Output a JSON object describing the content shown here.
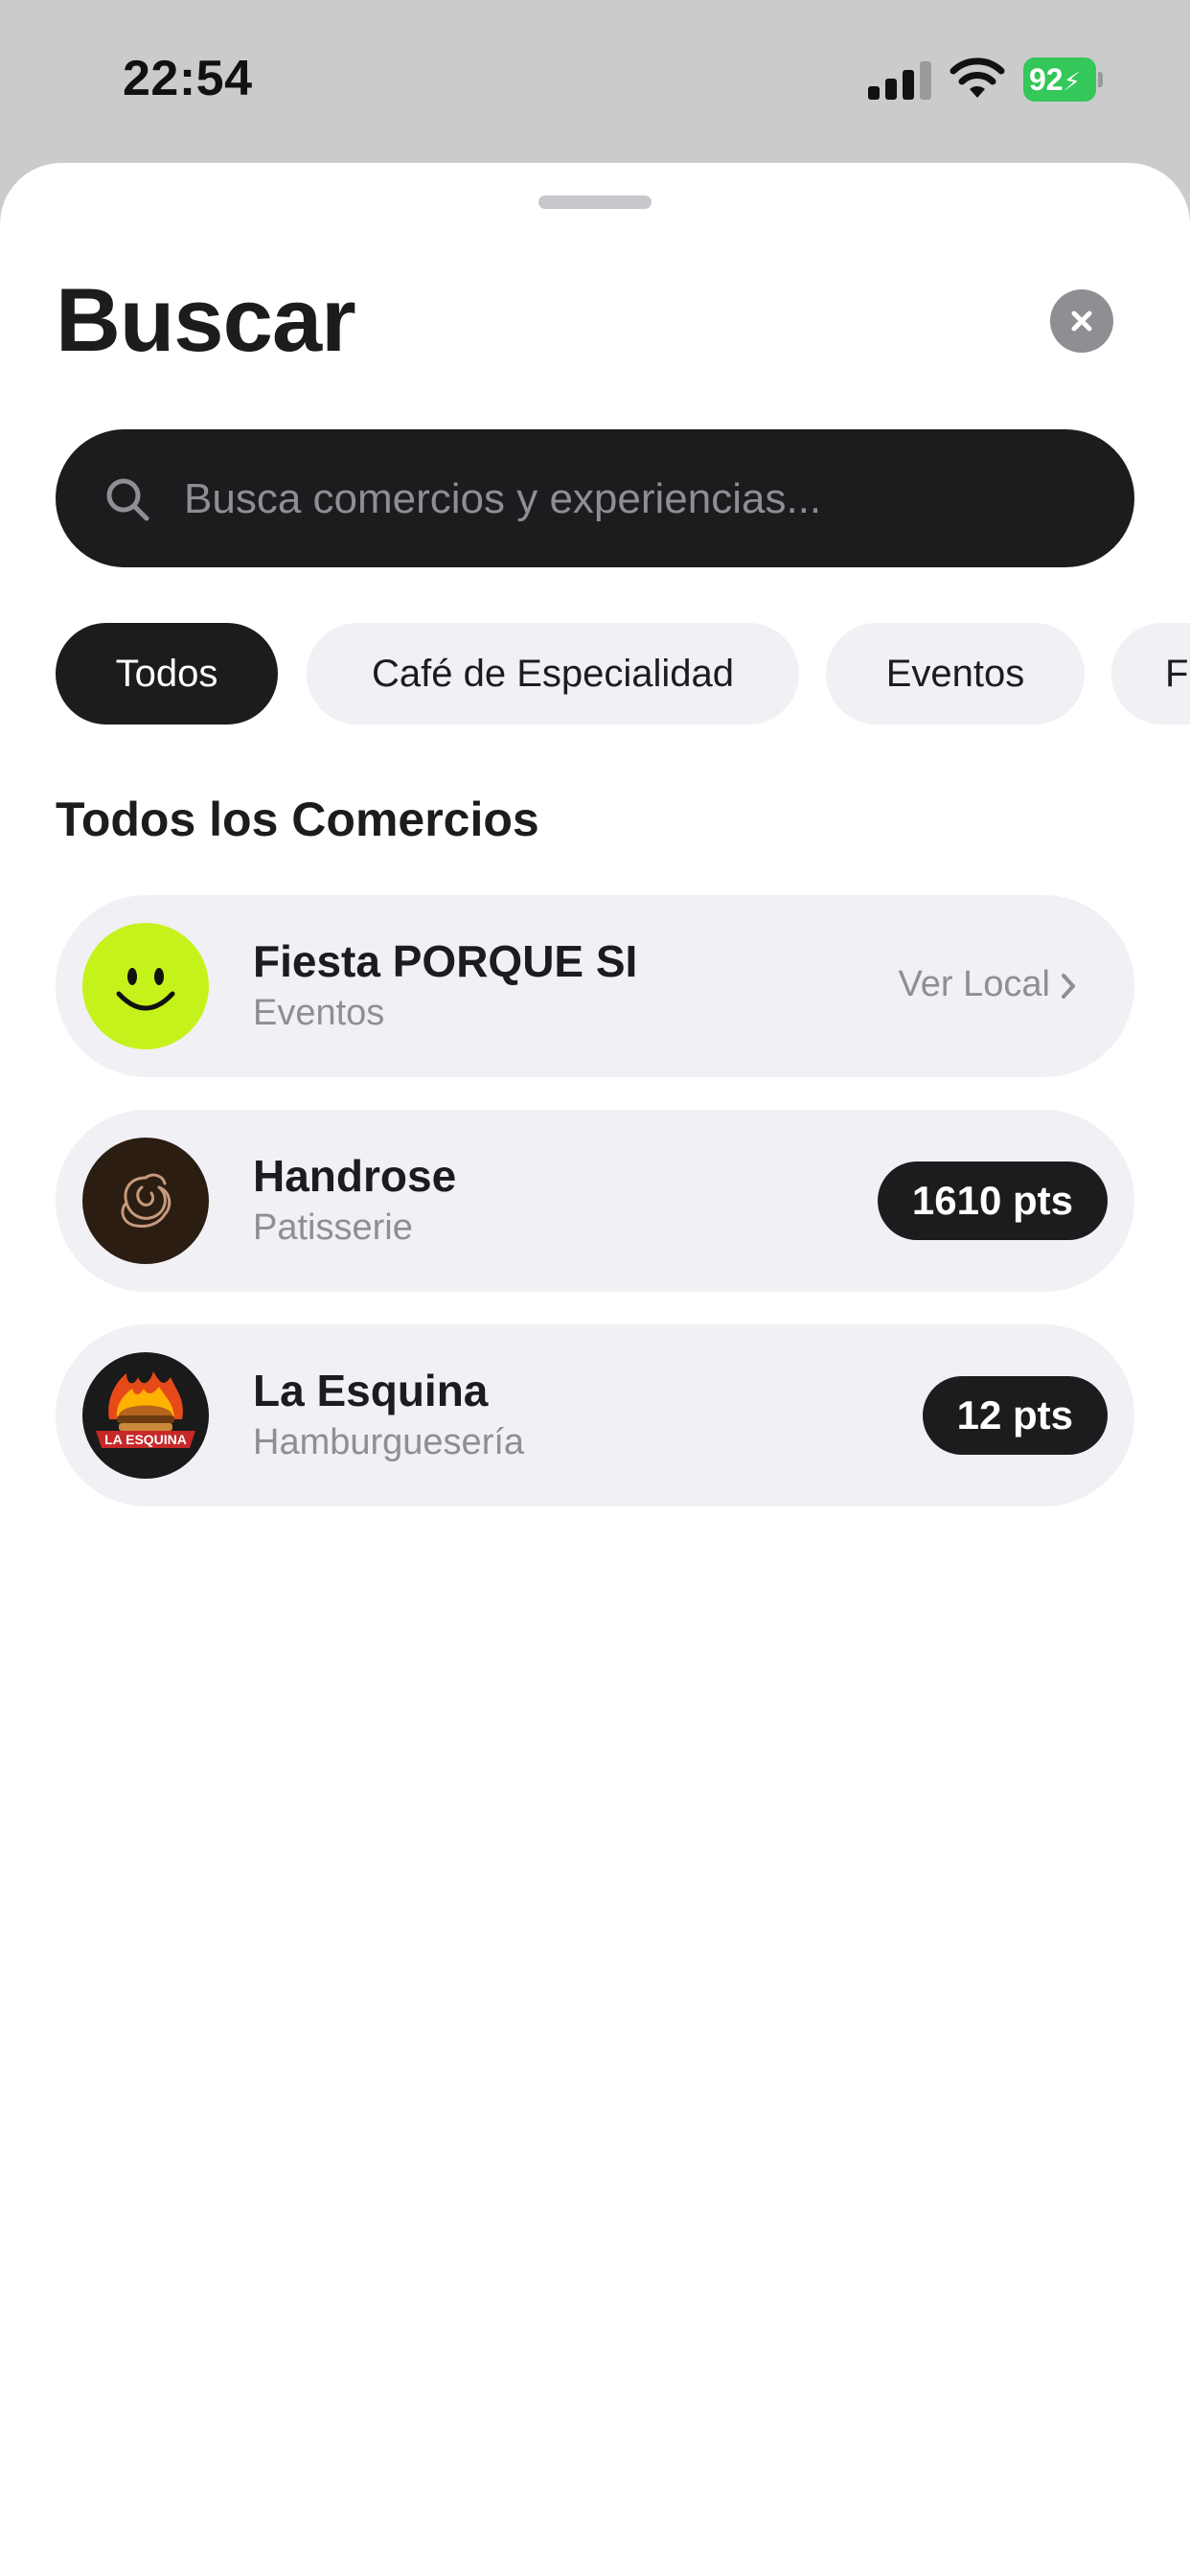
{
  "status_bar": {
    "time": "22:54",
    "battery": "92"
  },
  "sheet": {
    "title": "Buscar",
    "search": {
      "placeholder": "Busca comercios y experiencias..."
    },
    "filters": [
      {
        "label": "Todos",
        "active": true
      },
      {
        "label": "Café de Especialidad",
        "active": false
      },
      {
        "label": "Eventos",
        "active": false
      },
      {
        "label": "F",
        "active": false
      }
    ],
    "section_title": "Todos los Comercios",
    "merchants": [
      {
        "name": "Fiesta PORQUE SI",
        "category": "Eventos",
        "action": "Ver Local",
        "avatar_icon": "smiley-icon",
        "avatar_color": "#c6f21c"
      },
      {
        "name": "Handrose",
        "category": "Patisserie",
        "points": "1610 pts",
        "avatar_icon": "rose-icon",
        "avatar_color": "#2b1d12"
      },
      {
        "name": "La Esquina",
        "category": "Hamburguesería",
        "points": "12 pts",
        "avatar_icon": "burger-logo-icon",
        "avatar_color": "#1a1a1a",
        "logo_text": "LA ESQUINA"
      }
    ]
  }
}
